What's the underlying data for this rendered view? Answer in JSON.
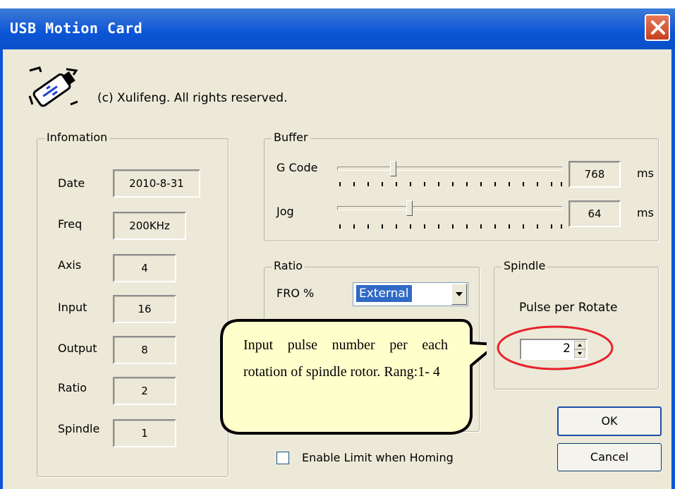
{
  "window": {
    "title": "USB Motion Card"
  },
  "header": {
    "copyright": "(c) Xulifeng.  All rights reserved."
  },
  "info": {
    "group_label": "Infomation",
    "rows": [
      {
        "label": "Date",
        "value": "2010-8-31"
      },
      {
        "label": "Freq",
        "value": "200KHz"
      },
      {
        "label": "Axis",
        "value": "4"
      },
      {
        "label": "Input",
        "value": "16"
      },
      {
        "label": "Output",
        "value": "8"
      },
      {
        "label": "Ratio",
        "value": "2"
      },
      {
        "label": "Spindle",
        "value": "1"
      }
    ]
  },
  "buffer": {
    "group_label": "Buffer",
    "gcode": {
      "label": "G Code",
      "value": "768",
      "unit": "ms"
    },
    "jog": {
      "label": "Jog",
      "value": "64",
      "unit": "ms"
    }
  },
  "ratio": {
    "group_label": "Ratio",
    "fro_label": "FRO %",
    "fro_selected": "External"
  },
  "spindle": {
    "group_label": "Spindle",
    "pulse_label": "Pulse per Rotate",
    "pulse_value": "2"
  },
  "callout": {
    "text": "Input pulse number per each rotation of spindle rotor.   Rang:1- 4"
  },
  "limit_checkbox": {
    "label": "Enable Limit when Homing",
    "checked": false
  },
  "buttons": {
    "ok": "OK",
    "cancel": "Cancel"
  },
  "colors": {
    "titlebar": "#0b55d6",
    "annotation": "#e8222a",
    "callout_fill": "#ffffcc"
  }
}
